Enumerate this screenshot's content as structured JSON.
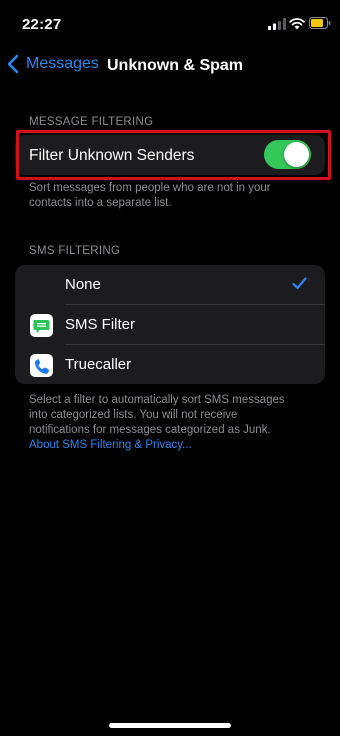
{
  "status_bar": {
    "time": "22:27"
  },
  "nav": {
    "back_label": "Messages",
    "title": "Unknown & Spam"
  },
  "message_filtering": {
    "header": "MESSAGE FILTERING",
    "label": "Filter Unknown Senders",
    "enabled": true,
    "footer": "Sort messages from people who are not in your contacts into a separate list."
  },
  "sms_filtering": {
    "header": "SMS FILTERING",
    "options": [
      {
        "label": "None",
        "selected": true,
        "icon": ""
      },
      {
        "label": "SMS Filter",
        "selected": false,
        "icon": "sms-filter-app-icon"
      },
      {
        "label": "Truecaller",
        "selected": false,
        "icon": "truecaller-app-icon"
      }
    ],
    "footer_lines": [
      "Select a filter to automatically sort SMS messages",
      "into categorized lists. You will not receive",
      "notifications for messages categorized as Junk."
    ],
    "link": "About SMS Filtering & Privacy..."
  },
  "colors": {
    "accent": "#2b87f0",
    "toggle_on": "#34c759",
    "highlight": "#d0101b"
  }
}
